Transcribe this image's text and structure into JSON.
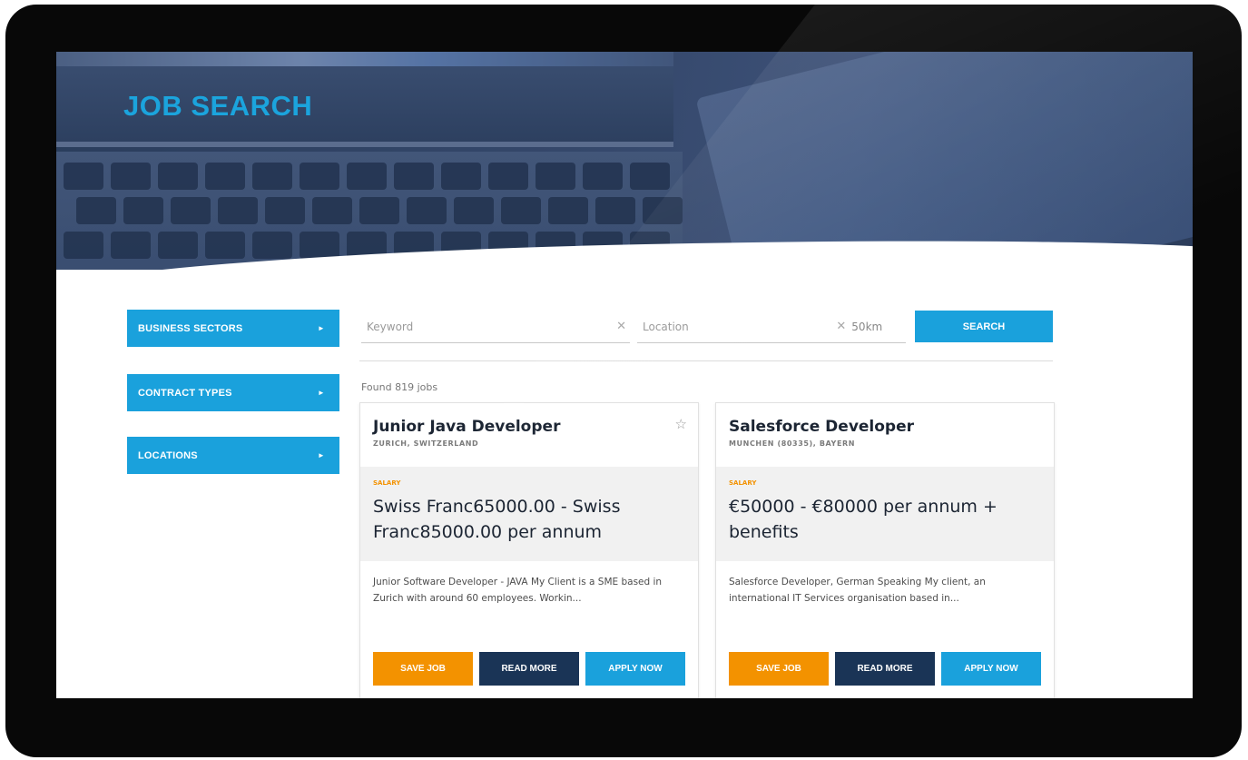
{
  "hero": {
    "title": "JOB SEARCH"
  },
  "filters": [
    {
      "label": "BUSINESS SECTORS"
    },
    {
      "label": "CONTRACT TYPES"
    },
    {
      "label": "LOCATIONS"
    }
  ],
  "search": {
    "keyword_placeholder": "Keyword",
    "location_placeholder": "Location",
    "radius": "50km",
    "button_label": "SEARCH",
    "clear_glyph": "✕"
  },
  "results": {
    "count_text": "Found 819 jobs"
  },
  "jobs": [
    {
      "title": "Junior Java Developer",
      "location": "ZURICH, SWITZERLAND",
      "salary_label": "SALARY",
      "salary": "Swiss Franc65000.00 - Swiss Franc85000.00 per annum",
      "description": "Junior Software Developer - JAVA My Client is a SME based in Zurich with around 60 employees. Workin...",
      "favorite_icon": "star-outline",
      "buttons": {
        "save": "SAVE JOB",
        "read": "READ MORE",
        "apply": "APPLY NOW"
      }
    },
    {
      "title": "Salesforce Developer",
      "location": "MUNCHEN (80335), BAYERN",
      "salary_label": "SALARY",
      "salary": "€50000 - €80000 per annum + benefits",
      "description": "Salesforce Developer, German Speaking My client, an international IT Services organisation based in...",
      "buttons": {
        "save": "SAVE JOB",
        "read": "READ MORE",
        "apply": "APPLY NOW"
      }
    }
  ],
  "colors": {
    "accent_blue": "#1aa1dc",
    "navy": "#1a3456",
    "orange": "#f39200"
  }
}
